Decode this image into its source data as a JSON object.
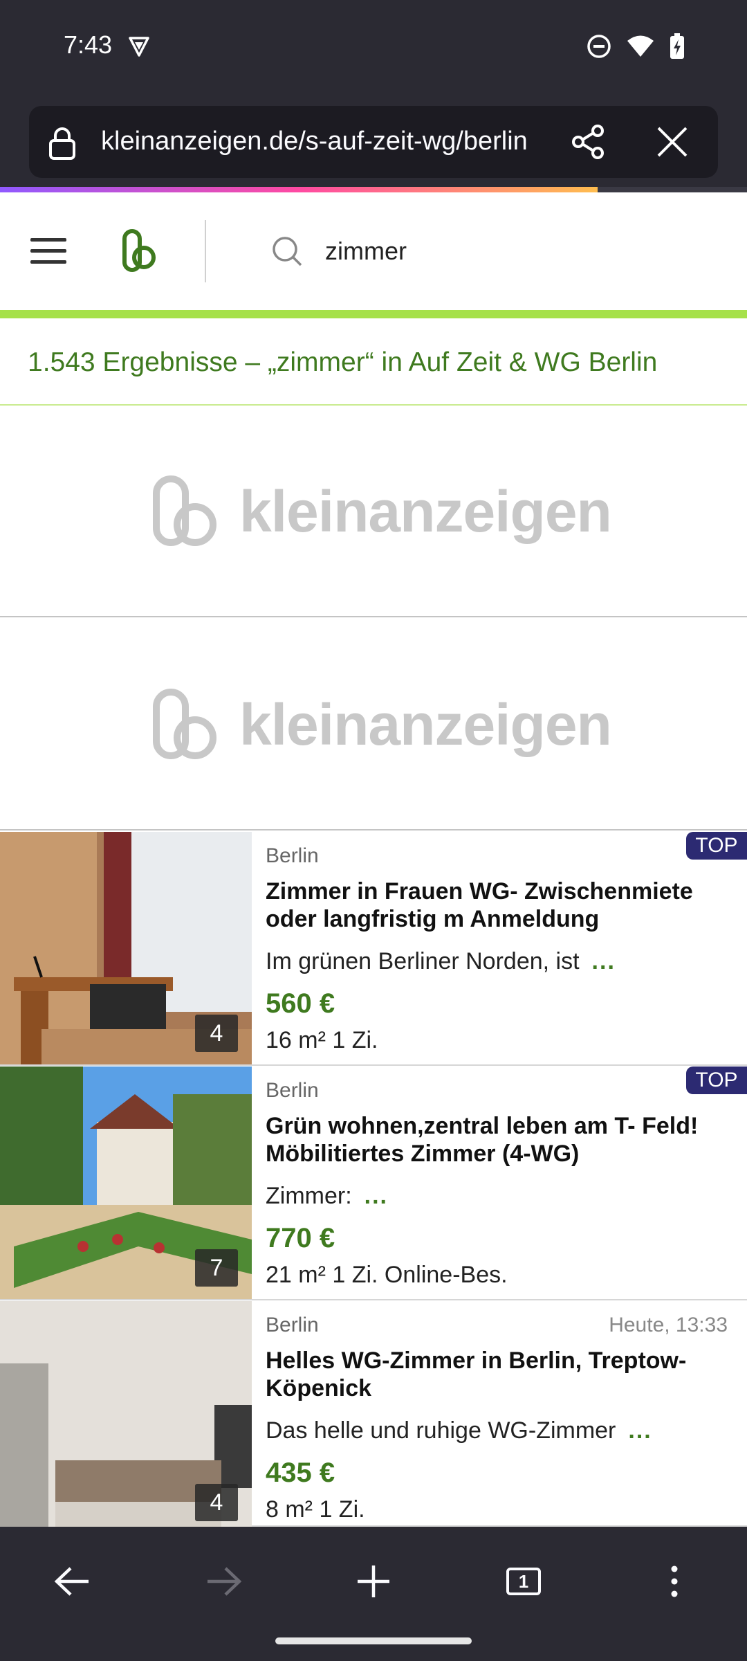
{
  "status": {
    "time": "7:43"
  },
  "browser": {
    "url": "kleinanzeigen.de/s-auf-zeit-wg/berlin",
    "tab_count": "1",
    "load_progress": 0.8
  },
  "header": {
    "search_value": "zimmer"
  },
  "results": {
    "text": "1.543 Ergebnisse – „zimmer“ in Auf Zeit & WG Berlin"
  },
  "ads": {
    "brand": "kleinanzeigen"
  },
  "listings": [
    {
      "location": "Berlin",
      "badge": "TOP",
      "date": "",
      "title": "Zimmer in Frauen WG- Zwischenmiete oder langfristig m Anmeldung",
      "description": "Im grünen Berliner Norden, ist",
      "more": "...",
      "price": "560 €",
      "meta": "16 m² 1 Zi.",
      "image_count": "4"
    },
    {
      "location": "Berlin",
      "badge": "TOP",
      "date": "",
      "title": "Grün wohnen,zentral leben am T- Feld! Möbilitiertes Zimmer (4-WG)",
      "description": "Zimmer:",
      "more": "...",
      "price": "770 €",
      "meta": "21 m² 1 Zi. Online-Bes.",
      "image_count": "7"
    },
    {
      "location": "Berlin",
      "badge": "",
      "date": "Heute, 13:33",
      "title": "Helles WG-Zimmer in Berlin, Treptow-Köpenick",
      "description": "Das helle und ruhige WG-Zimmer",
      "more": "...",
      "price": "435 €",
      "meta": "8 m² 1 Zi.",
      "image_count": "4"
    }
  ],
  "colors": {
    "brand_green": "#3f7a1f",
    "accent_lime": "#a6e14a",
    "top_badge": "#2c2a72",
    "browser_chrome": "#2b2a33"
  }
}
